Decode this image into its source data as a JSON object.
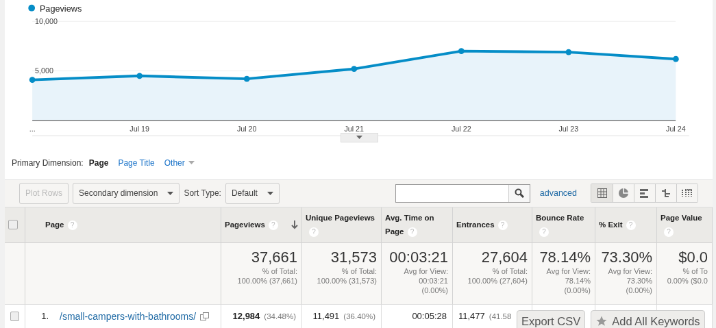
{
  "chart_data": {
    "type": "area",
    "categories": [
      "...",
      "Jul 19",
      "Jul 20",
      "Jul 21",
      "Jul 22",
      "Jul 23",
      "Jul 24"
    ],
    "series": [
      {
        "name": "Pageviews",
        "color": "#058dc7",
        "values": [
          4100,
          4500,
          4200,
          5200,
          7000,
          6900,
          6200
        ]
      }
    ],
    "ylim": [
      0,
      10000
    ],
    "yticks": [
      {
        "value": 5000,
        "label": "5,000"
      },
      {
        "value": 10000,
        "label": "10,000"
      }
    ]
  },
  "primary_dimension": {
    "label": "Primary Dimension:",
    "options": [
      {
        "label": "Page",
        "selected": true,
        "kind": "link"
      },
      {
        "label": "Page Title",
        "selected": false,
        "kind": "link"
      },
      {
        "label": "Other",
        "selected": false,
        "kind": "menu"
      }
    ]
  },
  "toolbar": {
    "plot_rows": {
      "label": "Plot Rows",
      "disabled": true
    },
    "secondary_dimension": "Secondary dimension",
    "sort_label": "Sort Type:",
    "sort_value": "Default",
    "advanced": "advanced",
    "views": [
      {
        "kind": "grid",
        "selected": true
      },
      {
        "kind": "pie",
        "selected": false
      },
      {
        "kind": "bars",
        "selected": false
      },
      {
        "kind": "pivot",
        "selected": false
      },
      {
        "kind": "compare",
        "selected": false
      }
    ]
  },
  "table": {
    "select_all": {
      "checked": false
    },
    "columns": [
      {
        "label": "Page",
        "help": "?",
        "sorted": false
      },
      {
        "label": "Pageviews",
        "help": "?",
        "sorted": true
      },
      {
        "label": "Unique Pageviews",
        "help": "?",
        "sorted": false
      },
      {
        "label": "Avg. Time on Page",
        "help": "?",
        "sorted": false
      },
      {
        "label": "Entrances",
        "help": "?",
        "sorted": false
      },
      {
        "label": "Bounce Rate",
        "help": "?",
        "sorted": false
      },
      {
        "label": "% Exit",
        "help": "?",
        "sorted": false
      },
      {
        "label": "Page Value",
        "help": "?",
        "sorted": false
      }
    ],
    "totals": [
      {
        "value": "37,661",
        "note": [
          "% of Total:",
          "100.00% (37,661)"
        ]
      },
      {
        "value": "31,573",
        "note": [
          "% of Total:",
          "100.00% (31,573)"
        ]
      },
      {
        "value": "00:03:21",
        "note": [
          "Avg for View:",
          "00:03:21",
          "(0.00%)"
        ]
      },
      {
        "value": "27,604",
        "note": [
          "% of Total:",
          "100.00% (27,604)"
        ]
      },
      {
        "value": "78.14%",
        "note": [
          "Avg for View:",
          "78.14%",
          "(0.00%)"
        ]
      },
      {
        "value": "73.30%",
        "note": [
          "Avg for View:",
          "73.30%",
          "(0.00%)"
        ]
      },
      {
        "value": "$0.0",
        "note": [
          "% of To",
          "0.00% ($0.0"
        ]
      }
    ],
    "rows": [
      {
        "checked": false,
        "index": "1.",
        "cells": [
          {
            "value": "/small-campers-with-bathrooms/",
            "kind": "link"
          },
          {
            "value": "12,984",
            "share": "(34.48%)",
            "kind": "metric"
          },
          {
            "value": "11,491",
            "share": "(36.40%)",
            "kind": "metric"
          },
          {
            "value": "00:05:28",
            "kind": "metric"
          },
          {
            "value": "11,477",
            "share": "(41.58",
            "kind": "metric"
          }
        ]
      }
    ]
  },
  "floating_buttons": [
    {
      "label": "Export CSV",
      "kind": "plain"
    },
    {
      "label": "Add All Keywords",
      "kind": "star"
    }
  ]
}
